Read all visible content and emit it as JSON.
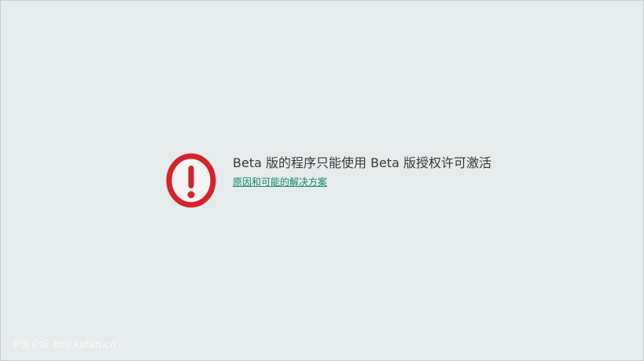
{
  "message": {
    "icon": "error-alert-icon",
    "title": "Beta 版的程序只能使用 Beta 版授权许可激活",
    "link_label": "原因和可能的解决方案"
  },
  "watermark": {
    "text": "卡饭论坛 bbs.kafan.cn"
  },
  "colors": {
    "background": "#e6ebec",
    "icon_red": "#d3242a",
    "link": "#0f8a70",
    "title_text": "#3a3a3a"
  }
}
